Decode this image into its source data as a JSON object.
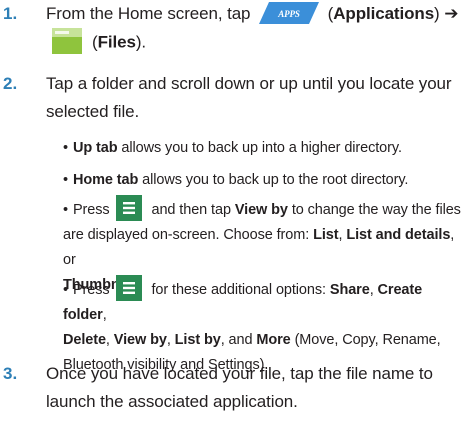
{
  "steps": [
    {
      "number": "1.",
      "line1_prefix": "From the Home screen, tap",
      "apps_icon_text": "APPS",
      "apps_label": "Applications",
      "arrow": "➔",
      "files_label": "Files"
    },
    {
      "number": "2.",
      "text": "Tap a folder and scroll down or up until you locate your selected file."
    },
    {
      "number": "3.",
      "text": "Once you have located your file, tap the file name to launch the associated application."
    }
  ],
  "bullets": {
    "up": {
      "bold": "Up tab",
      "rest": " allows you to back up into a higher directory."
    },
    "home": {
      "bold": "Home tab",
      "rest": " allows you to back up to the root directory."
    },
    "viewby": {
      "press": "Press",
      "mid": " and then tap ",
      "bold1": "View by",
      "rest1": " to change the way the files are displayed on-screen. Choose from: ",
      "bold2": "List",
      "sep1": ", ",
      "bold3": "List and details",
      "sep2": ", or ",
      "bold4": "Thumbnail",
      "end": "."
    },
    "options": {
      "press": "Press",
      "mid": " for these additional options: ",
      "o1": "Share",
      "c1": ", ",
      "o2": "Create folder",
      "c2": ", ",
      "o3": "Delete",
      "c3": ", ",
      "o4": "View by",
      "c4": ", ",
      "o5": "List by",
      "c5": ", and ",
      "o6": "More",
      "rest": " (Move, Copy, Rename, Bluetooth visibility and Settings)."
    }
  },
  "colors": {
    "step_number": "#2d7fb6",
    "apps_icon": "#3b8fd9",
    "menu_icon": "#2b8b54"
  },
  "icons": [
    "apps-icon",
    "files-icon",
    "menu-icon"
  ]
}
